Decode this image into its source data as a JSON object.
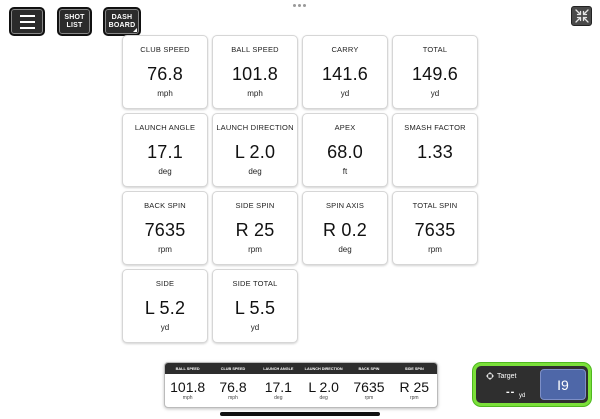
{
  "toolbar": {
    "shot_list_label": "SHOT\nLIST",
    "dashboard_label": "DASH\nBOARD",
    "menu_icon": "hamburger-menu-icon",
    "collapse_icon": "collapse-arrows-icon"
  },
  "metrics": [
    {
      "label": "CLUB SPEED",
      "value": "76.8",
      "unit": "mph"
    },
    {
      "label": "BALL SPEED",
      "value": "101.8",
      "unit": "mph"
    },
    {
      "label": "CARRY",
      "value": "141.6",
      "unit": "yd"
    },
    {
      "label": "TOTAL",
      "value": "149.6",
      "unit": "yd"
    },
    {
      "label": "LAUNCH ANGLE",
      "value": "17.1",
      "unit": "deg"
    },
    {
      "label": "LAUNCH DIRECTION",
      "value": "L 2.0",
      "unit": "deg"
    },
    {
      "label": "APEX",
      "value": "68.0",
      "unit": "ft"
    },
    {
      "label": "SMASH FACTOR",
      "value": "1.33",
      "unit": ""
    },
    {
      "label": "BACK SPIN",
      "value": "7635",
      "unit": "rpm"
    },
    {
      "label": "SIDE SPIN",
      "value": "R 25",
      "unit": "rpm"
    },
    {
      "label": "SPIN AXIS",
      "value": "R 0.2",
      "unit": "deg"
    },
    {
      "label": "TOTAL SPIN",
      "value": "7635",
      "unit": "rpm"
    },
    {
      "label": "SIDE",
      "value": "L 5.2",
      "unit": "yd"
    },
    {
      "label": "SIDE TOTAL",
      "value": "L 5.5",
      "unit": "yd"
    }
  ],
  "strip": [
    {
      "label": "BALL SPEED",
      "value": "101.8",
      "unit": "mph"
    },
    {
      "label": "CLUB SPEED",
      "value": "76.8",
      "unit": "mph"
    },
    {
      "label": "LAUNCH ANGLE",
      "value": "17.1",
      "unit": "deg"
    },
    {
      "label": "LAUNCH DIRECTION",
      "value": "L 2.0",
      "unit": "deg"
    },
    {
      "label": "BACK SPIN",
      "value": "7635",
      "unit": "rpm"
    },
    {
      "label": "SIDE SPIN",
      "value": "R 25",
      "unit": "rpm"
    }
  ],
  "target": {
    "label": "Target",
    "value": "--",
    "unit": "yd",
    "icon": "crosshair-icon"
  },
  "club": {
    "label": "I9"
  },
  "colors": {
    "accent_green": "#7be03a",
    "club_blue": "#4e67a8",
    "dark_button": "#2b2b2b"
  }
}
